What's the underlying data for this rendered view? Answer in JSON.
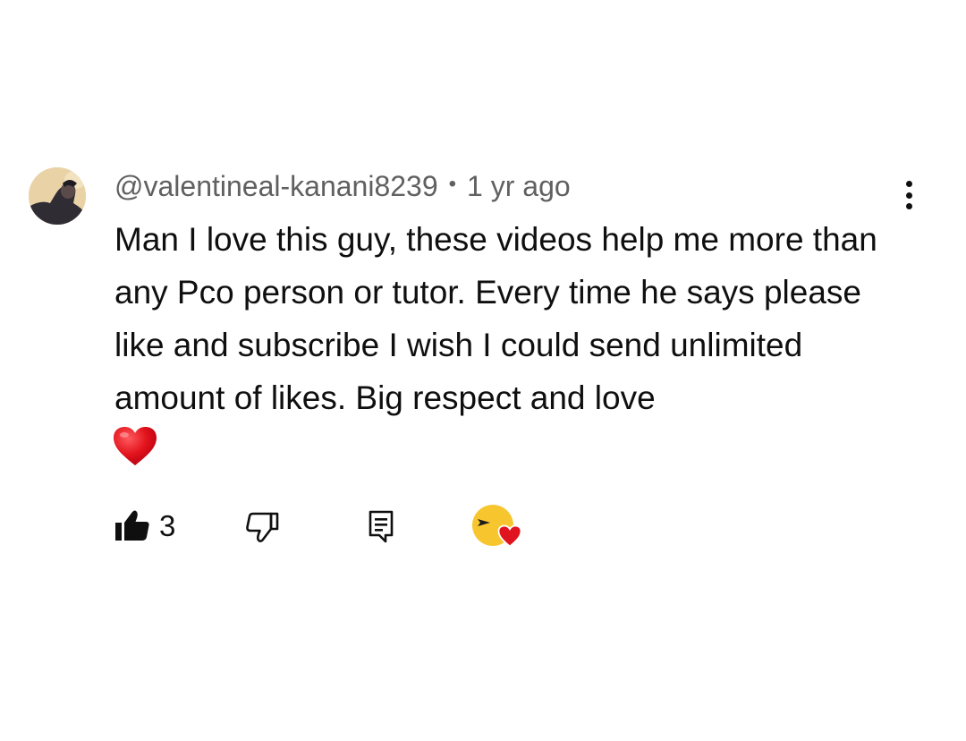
{
  "comment": {
    "username": "@valentineal-kanani8239",
    "separator": "•",
    "timestamp": "1 yr ago",
    "text": "Man I love this guy, these videos help me more than any Pco person or tutor. Every time he says please like and subscribe I wish I could send unlimited amount of likes. Big respect and love",
    "emoji": "heart"
  },
  "actions": {
    "like_count": "3",
    "like_icon": "thumbs-up-icon",
    "dislike_icon": "thumbs-down-icon",
    "reply_icon": "reply-icon",
    "creator_heart_icon": "creator-heart-icon"
  },
  "colors": {
    "text_primary": "#0f0f0f",
    "text_secondary": "#606060",
    "heart_red": "#e0141e",
    "creator_avatar_yellow": "#f7c62f"
  }
}
